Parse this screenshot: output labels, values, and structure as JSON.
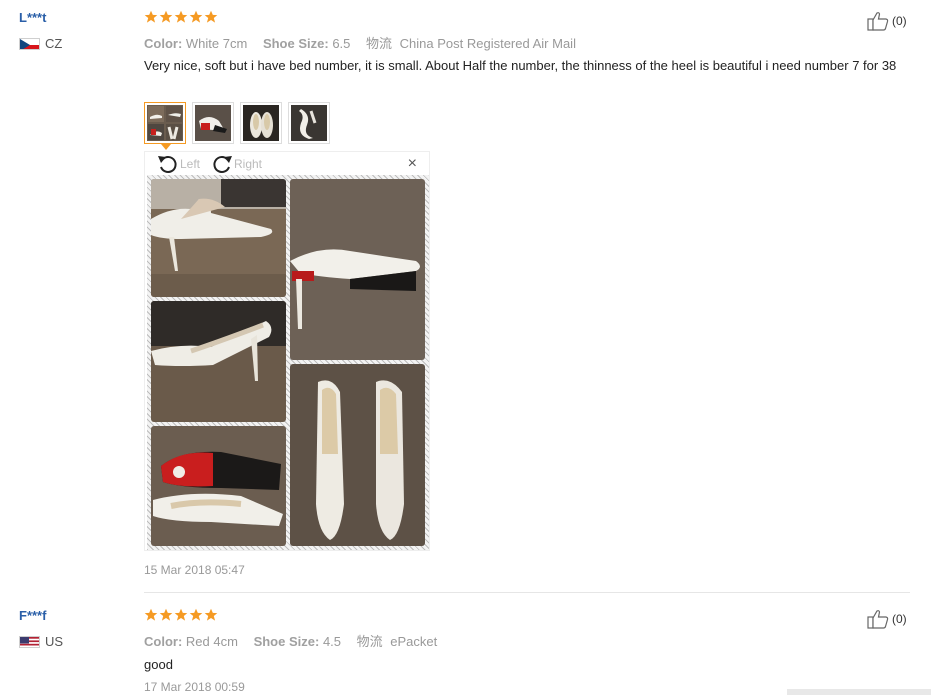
{
  "reviews": [
    {
      "user": "L***t",
      "country": "CZ",
      "rating": 5,
      "color_label": "Color:",
      "color_value": "White 7cm",
      "size_label": "Shoe Size:",
      "size_value": "6.5",
      "shipping_label": "物流",
      "shipping_value": "China Post Registered Air Mail",
      "text": "Very nice, soft but i have bed number, it is small. About Half the number, the thinness of the heel is beautiful i need number 7 for 38",
      "helpful": "(0)",
      "photo_count": 4,
      "date": "15 Mar 2018 05:47"
    },
    {
      "user": "F***f",
      "country": "US",
      "rating": 5,
      "color_label": "Color:",
      "color_value": "Red 4cm",
      "size_label": "Shoe Size:",
      "size_value": "4.5",
      "shipping_label": "物流",
      "shipping_value": "ePacket",
      "text": "good",
      "helpful": "(0)",
      "date": "17 Mar 2018 00:59"
    }
  ],
  "viewer": {
    "rotate_left": "Left",
    "rotate_right": "Right",
    "close": "×"
  },
  "colors": {
    "star": "#f59a23",
    "user_link": "#2a5fa8",
    "muted": "#999999"
  }
}
